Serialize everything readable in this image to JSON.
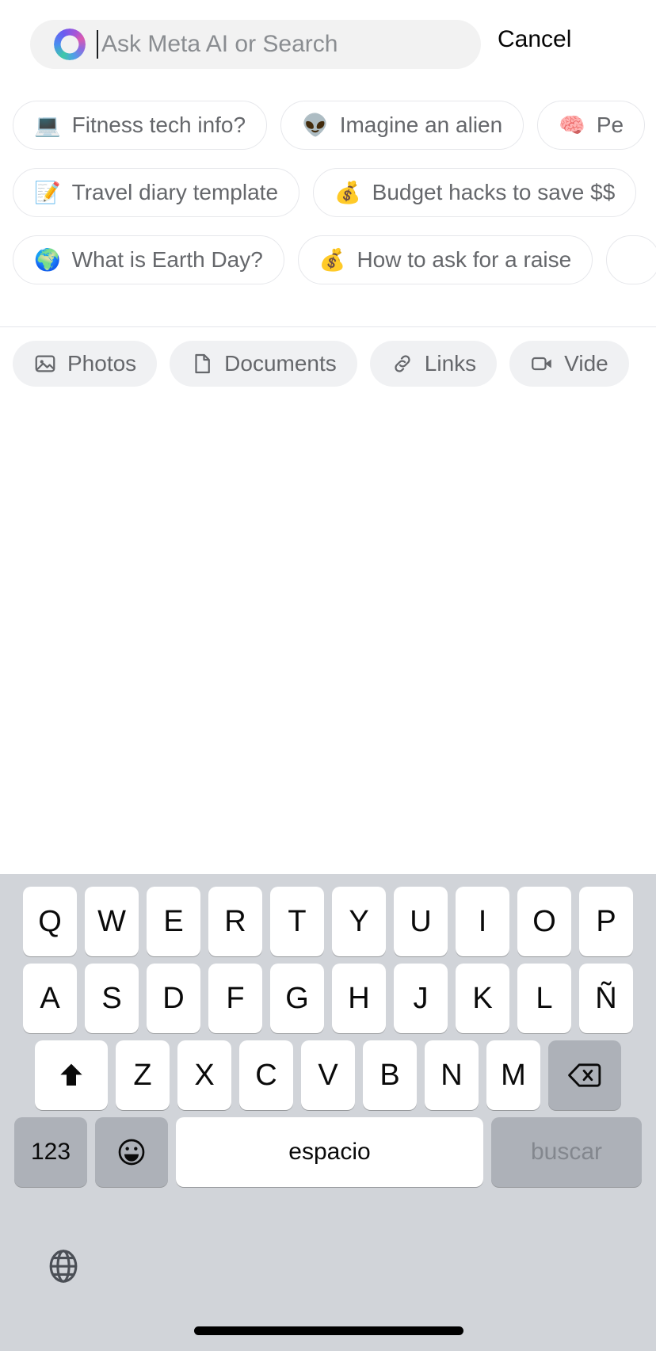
{
  "search": {
    "placeholder": "Ask Meta AI or Search",
    "value": "",
    "ai_icon": "meta-ai-ring-icon",
    "cancel_label": "Cancel"
  },
  "suggestions": {
    "rows": [
      [
        {
          "emoji": "💻",
          "label": "Fitness tech info?"
        },
        {
          "emoji": "👽",
          "label": "Imagine an alien"
        },
        {
          "emoji": "🧠",
          "label": "Pe"
        }
      ],
      [
        {
          "emoji": "📝",
          "label": "Travel diary template"
        },
        {
          "emoji": "💰",
          "label": "Budget hacks to save $$"
        }
      ],
      [
        {
          "emoji": "🌍",
          "label": "What is Earth Day?"
        },
        {
          "emoji": "💰",
          "label": "How to ask for a raise"
        },
        {
          "emoji": "",
          "label": ""
        }
      ]
    ]
  },
  "filters": [
    {
      "icon": "photos-icon",
      "label": "Photos"
    },
    {
      "icon": "documents-icon",
      "label": "Documents"
    },
    {
      "icon": "links-icon",
      "label": "Links"
    },
    {
      "icon": "videos-icon",
      "label": "Vide"
    }
  ],
  "keyboard": {
    "language": "es",
    "row1": [
      "Q",
      "W",
      "E",
      "R",
      "T",
      "Y",
      "U",
      "I",
      "O",
      "P"
    ],
    "row2": [
      "A",
      "S",
      "D",
      "F",
      "G",
      "H",
      "J",
      "K",
      "L",
      "Ñ"
    ],
    "row3_letters": [
      "Z",
      "X",
      "C",
      "V",
      "B",
      "N",
      "M"
    ],
    "shift_icon": "shift-arrow-icon",
    "backspace_icon": "backspace-icon",
    "numbers_label": "123",
    "emoji_icon": "emoji-smiley-icon",
    "space_label": "espacio",
    "return_label": "buscar",
    "globe_icon": "globe-icon"
  },
  "colors": {
    "accent_blue": "#4a8df0",
    "accent_purple": "#a855d6",
    "accent_green": "#3ec9a7",
    "text_primary": "#050505",
    "text_secondary": "#65676b",
    "placeholder": "#8a8d91",
    "field_bg": "#f2f2f2",
    "pill_bg": "#f0f1f3",
    "keyboard_bg": "#d1d4d9",
    "key_bg": "#ffffff",
    "key_fn_bg": "#adb1b8"
  }
}
